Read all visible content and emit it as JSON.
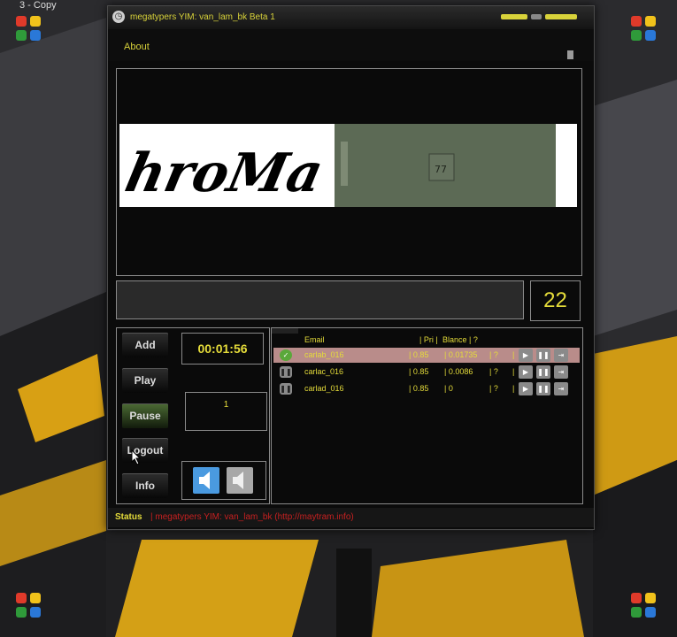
{
  "desktop": {
    "label": "3 - Copy"
  },
  "colors": {
    "accent": "#e5dc3a",
    "status_red": "#c62020",
    "selected_row": "#b98c8a"
  },
  "window": {
    "title": "megatypers YIM: van_lam_bk Beta 1",
    "menu": {
      "about": "About"
    }
  },
  "captcha": {
    "text": "hroMa",
    "inline_number": "77"
  },
  "answer": {
    "value": "",
    "count": "22"
  },
  "controls": {
    "add": "Add",
    "play": "Play",
    "pause": "Pause",
    "logout": "Logout",
    "info": "Info",
    "timer": "00:01:56",
    "count": "1",
    "sound_on_icon": "speaker-icon",
    "sound_off_icon": "speaker-muted-icon"
  },
  "accounts": {
    "headers": {
      "email": "Email",
      "pri": "| Pri |",
      "balance": "Blance | ?"
    },
    "rows": [
      {
        "email": "carlab_016",
        "pri": "| 0.85",
        "balance": "| 0.01735",
        "q": "| ?",
        "sep": "|",
        "selected": true,
        "status_icon": "check-icon"
      },
      {
        "email": "carlac_016",
        "pri": "| 0.85",
        "balance": "| 0.0086",
        "q": "| ?",
        "sep": "|",
        "selected": false,
        "status_icon": "pause-icon"
      },
      {
        "email": "carlad_016",
        "pri": "| 0.85",
        "balance": "| 0",
        "q": "| ?",
        "sep": "|",
        "selected": false,
        "status_icon": "pause-icon"
      }
    ]
  },
  "status": {
    "label": "Status",
    "text": "| megatypers YIM: van_lam_bk (http://maytram.info)"
  }
}
